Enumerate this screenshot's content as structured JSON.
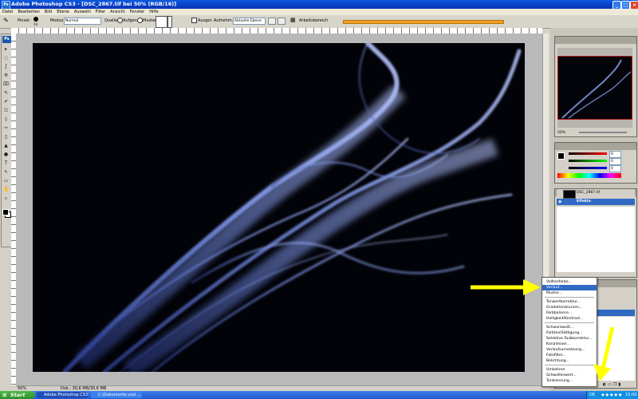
{
  "window": {
    "title": "Adobe Photoshop CS3 - [DSC_2867.tif bei 50% (RGB/16)]",
    "controls": [
      "_",
      "□",
      "×"
    ]
  },
  "menu": [
    "Datei",
    "Bearbeiten",
    "Bild",
    "Ebene",
    "Auswahl",
    "Filter",
    "Ansicht",
    "Fenster",
    "Hilfe"
  ],
  "options": {
    "pinsel_label": "Pinsel:",
    "brush_size": "14",
    "modus_label": "Modus:",
    "modus_value": "Normal",
    "quelle_label": "Quelle:",
    "aufgen_label": "Aufgen.",
    "muster_label": "Muster:",
    "ausger_label": "Ausger.",
    "aufnehm_label": "Aufnehm.:",
    "aufnehm_value": "Aktuelle Ebene",
    "workspace_label": "Arbeitsbereich"
  },
  "status": {
    "zoom": "50%",
    "doc": "Dok.: 30,6 MB/30,6 MB"
  },
  "navigator": {
    "zoom": "50%"
  },
  "color_panel": {
    "values": [
      "0",
      "0",
      "0"
    ]
  },
  "layers": {
    "document_layer": "DSC_2867.tif",
    "selected_layer": "Effekte"
  },
  "popup_menu": {
    "groups": [
      [
        "Volltonfarbe...",
        "Verlauf...",
        "Muster..."
      ],
      [
        "Tonwertkorrektur...",
        "Gradationskurven...",
        "Farbbalance...",
        "Helligkeit/Kontrast..."
      ],
      [
        "Schwarzweiß...",
        "Farbton/Sättigung...",
        "Selektive Farbkorrektur...",
        "Kanalmixer...",
        "Verlaufsumsetzung...",
        "Fotofilter...",
        "Belichtung..."
      ],
      [
        "Umkehren",
        "Schwellenwert...",
        "Tontrennung..."
      ]
    ],
    "selected": "Verlauf..."
  },
  "taskbar": {
    "start": "Start",
    "tasks": [
      "Adobe Photoshop CS3...",
      "C:\\Dokumente und ..."
    ],
    "lang": "DE",
    "clock": "15:00"
  },
  "colors": {
    "highlight": "#316ac5",
    "annotation_arrow": "#ffff00",
    "taskbar": "#2458d0"
  }
}
